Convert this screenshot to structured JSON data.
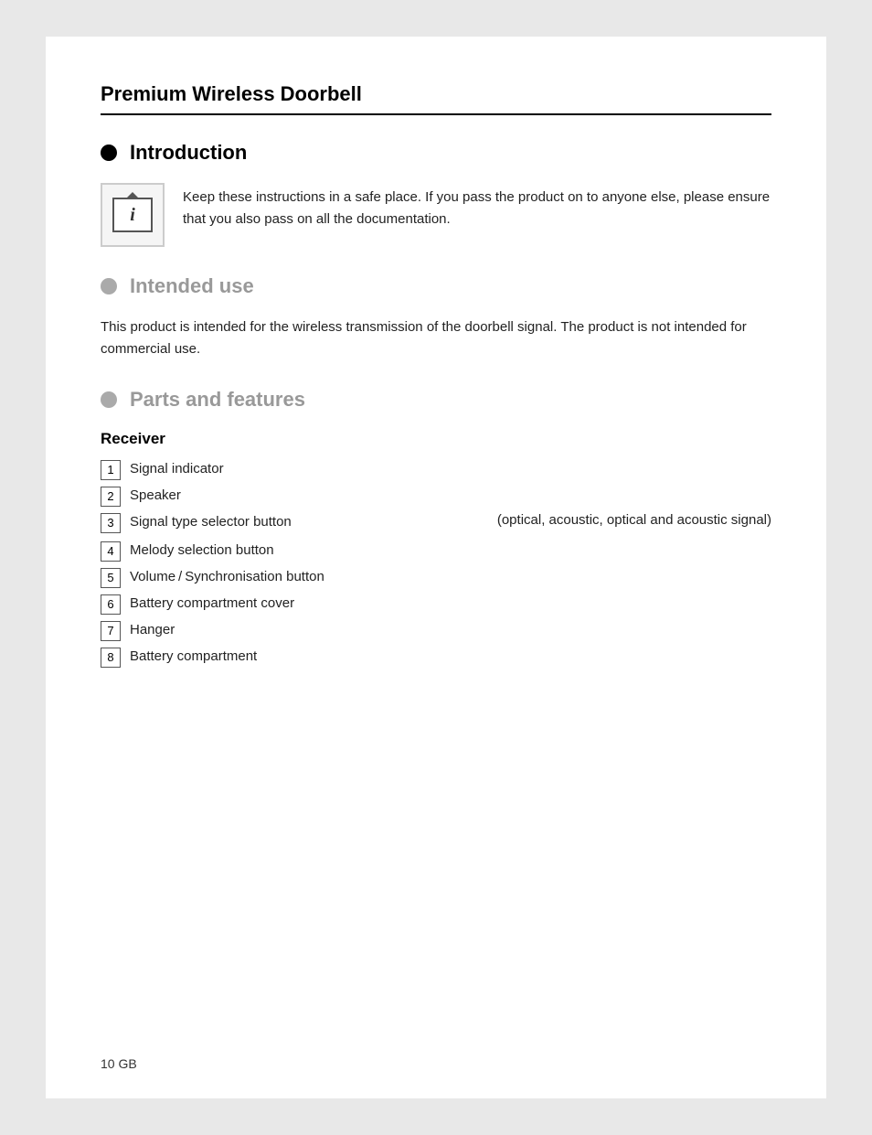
{
  "page": {
    "title": "Premium Wireless Doorbell",
    "footer": "10    GB",
    "sections": {
      "introduction": {
        "heading": "Introduction",
        "bullet": "black",
        "info_text": "Keep these instructions in a safe place. If you pass the product on to anyone else, please ensure that you also pass on all the documentation."
      },
      "intended_use": {
        "heading": "Intended use",
        "bullet": "gray",
        "body": "This product is intended for the wireless transmission of the doorbell signal. The product is not intended for commercial use."
      },
      "parts_and_features": {
        "heading": "Parts and features",
        "bullet": "gray",
        "receiver_title": "Receiver",
        "parts": [
          {
            "number": "1",
            "label": "Signal indicator",
            "sub": null
          },
          {
            "number": "2",
            "label": "Speaker",
            "sub": null
          },
          {
            "number": "3",
            "label": "Signal type selector button",
            "sub": "(optical, acoustic, optical and acoustic signal)"
          },
          {
            "number": "4",
            "label": "Melody selection button",
            "sub": null
          },
          {
            "number": "5",
            "label": "Volume / Synchronisation button",
            "sub": null
          },
          {
            "number": "6",
            "label": "Battery compartment cover",
            "sub": null
          },
          {
            "number": "7",
            "label": "Hanger",
            "sub": null
          },
          {
            "number": "8",
            "label": "Battery compartment",
            "sub": null
          }
        ]
      }
    }
  }
}
